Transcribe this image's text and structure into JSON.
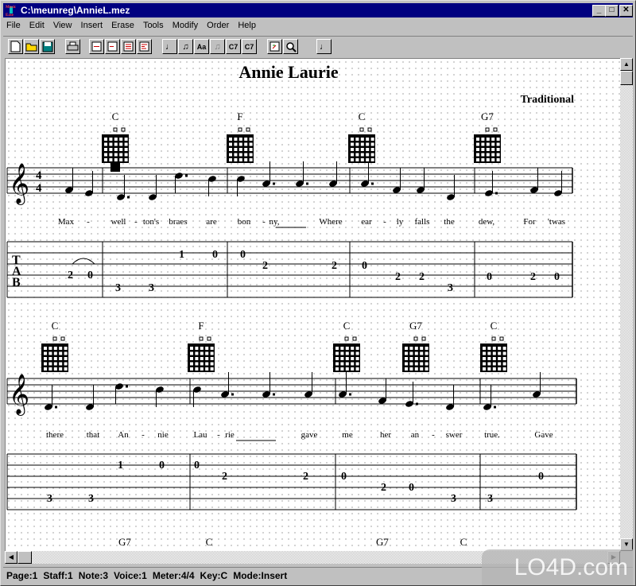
{
  "window": {
    "title": "C:\\meunreg\\AnnieL.mez",
    "controls": [
      "minimize",
      "maximize",
      "close"
    ]
  },
  "menu": [
    {
      "label": "File"
    },
    {
      "label": "Edit"
    },
    {
      "label": "View"
    },
    {
      "label": "Insert"
    },
    {
      "label": "Erase"
    },
    {
      "label": "Tools"
    },
    {
      "label": "Modify"
    },
    {
      "label": "Order"
    },
    {
      "label": "Help"
    }
  ],
  "toolbar": {
    "buttons": [
      {
        "name": "new-file-icon"
      },
      {
        "name": "open-folder-icon"
      },
      {
        "name": "save-disk-icon"
      },
      {
        "name": "print-icon"
      },
      {
        "name": "staff-layout-1-icon"
      },
      {
        "name": "staff-layout-2-icon"
      },
      {
        "name": "staff-layout-3-icon"
      },
      {
        "name": "staff-layout-4-icon"
      },
      {
        "name": "note-icon"
      },
      {
        "name": "add-note-icon"
      },
      {
        "name": "add-lyric-icon"
      },
      {
        "name": "note-disabled-icon"
      },
      {
        "name": "chord-c7-icon",
        "label": "C7"
      },
      {
        "name": "add-chord-icon",
        "label": "C7"
      },
      {
        "name": "transfer-icon"
      },
      {
        "name": "zoom-magnifier-icon"
      },
      {
        "name": "quarter-note-icon"
      }
    ]
  },
  "score": {
    "title": "Annie Laurie",
    "composer": "Traditional",
    "time_signature": "4/4",
    "tab_letters": [
      "T",
      "A",
      "B"
    ],
    "systems": [
      {
        "chords": [
          {
            "name": "C"
          },
          {
            "name": "F"
          },
          {
            "name": "C"
          },
          {
            "name": "G7"
          }
        ],
        "lyrics": [
          "Max",
          "-",
          "well",
          "-",
          "ton's",
          "braes",
          "are",
          "bon",
          "-",
          "ny,",
          "Where",
          "ear",
          "-",
          "ly",
          "falls",
          "the",
          "dew,",
          "For",
          "'twas"
        ],
        "tab": [
          {
            "fret": "2"
          },
          {
            "fret": "0"
          },
          {
            "fret": "3"
          },
          {
            "fret": "3"
          },
          {
            "fret": "1"
          },
          {
            "fret": "0"
          },
          {
            "fret": "0"
          },
          {
            "fret": "2"
          },
          {
            "fret": "2"
          },
          {
            "fret": "0"
          },
          {
            "fret": "2"
          },
          {
            "fret": "2"
          },
          {
            "fret": "3"
          },
          {
            "fret": "0"
          },
          {
            "fret": "2"
          },
          {
            "fret": "0"
          }
        ]
      },
      {
        "chords": [
          {
            "name": "C"
          },
          {
            "name": "F"
          },
          {
            "name": "C"
          },
          {
            "name": "G7"
          },
          {
            "name": "C"
          }
        ],
        "lyrics": [
          "there",
          "that",
          "An",
          "-",
          "nie",
          "Lau",
          "-",
          "rie",
          "gave",
          "me",
          "her",
          "an",
          "-",
          "swer",
          "true.",
          "Gave"
        ],
        "tab": [
          {
            "fret": "3"
          },
          {
            "fret": "3"
          },
          {
            "fret": "1"
          },
          {
            "fret": "0"
          },
          {
            "fret": "0"
          },
          {
            "fret": "2"
          },
          {
            "fret": "2"
          },
          {
            "fret": "0"
          },
          {
            "fret": "2"
          },
          {
            "fret": "0"
          },
          {
            "fret": "3"
          },
          {
            "fret": "3"
          },
          {
            "fret": "0"
          }
        ]
      },
      {
        "chords": [
          {
            "name": "G7"
          },
          {
            "name": "C"
          },
          {
            "name": "G7"
          },
          {
            "name": "C"
          }
        ]
      }
    ]
  },
  "status": {
    "page": "Page:1",
    "staff": "Staff:1",
    "note": "Note:3",
    "voice": "Voice:1",
    "meter": "Meter:4/4",
    "key": "Key:C",
    "mode": "Mode:Insert"
  },
  "watermark": "LO4D.com"
}
